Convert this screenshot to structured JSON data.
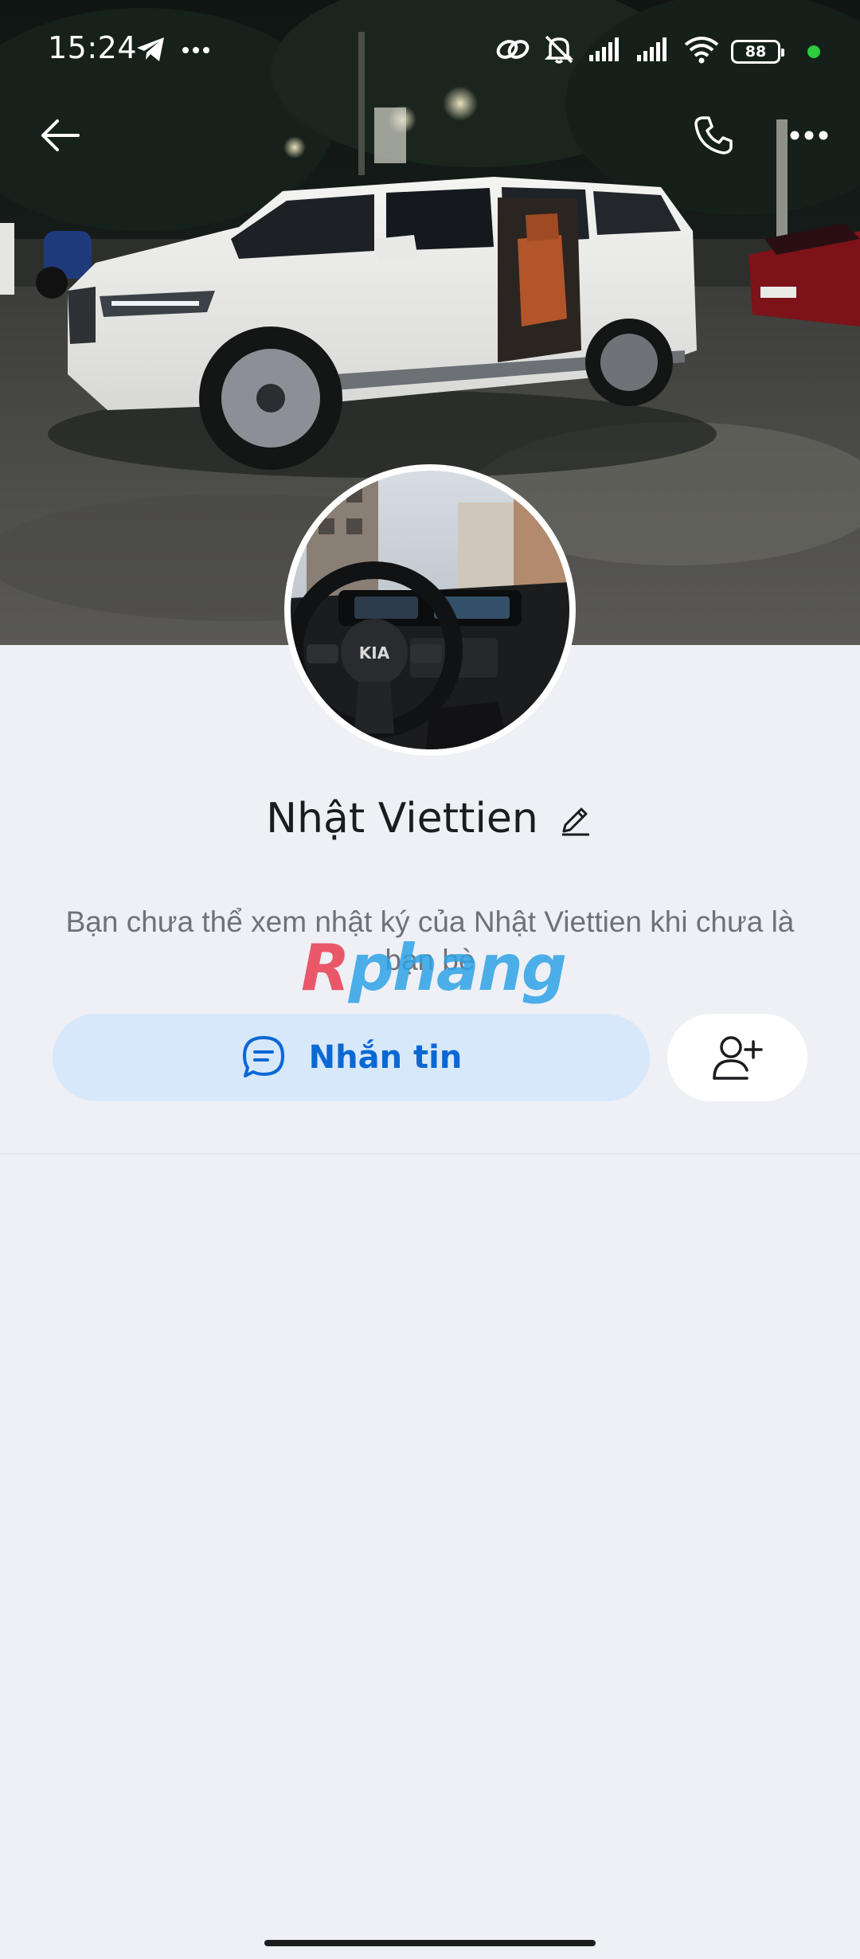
{
  "status_bar": {
    "time": "15:24",
    "battery_level": "88",
    "left_icons": [
      "telegram-icon",
      "more-dots-icon"
    ],
    "right_icons": [
      "link-icon",
      "muted-bell-icon",
      "cellular-signal-icon",
      "cellular-signal-icon",
      "wifi-icon",
      "battery-icon",
      "active-dot"
    ],
    "active_dot_color": "#2ecc40"
  },
  "header": {
    "back_icon": "arrow-left-icon",
    "call_icon": "phone-icon",
    "more_icon": "more-horizontal-icon"
  },
  "profile": {
    "name": "Nhật Viettien",
    "edit_icon": "pencil-icon",
    "notice": "Bạn chưa thể xem nhật ký của Nhật Viettien khi chưa là bạn bè",
    "cover_photo": "white minivan parked at night",
    "avatar_photo": "car steering wheel and dashboard"
  },
  "actions": {
    "message_label": "Nhắn tin",
    "message_icon": "chat-bubble-icon",
    "add_friend_icon": "add-user-icon"
  },
  "watermark": {
    "first": "R",
    "rest": "phang"
  },
  "colors": {
    "accent": "#0a68d4",
    "message_button_bg": "#d8e8fb",
    "page_bg": "#eef0f5"
  }
}
